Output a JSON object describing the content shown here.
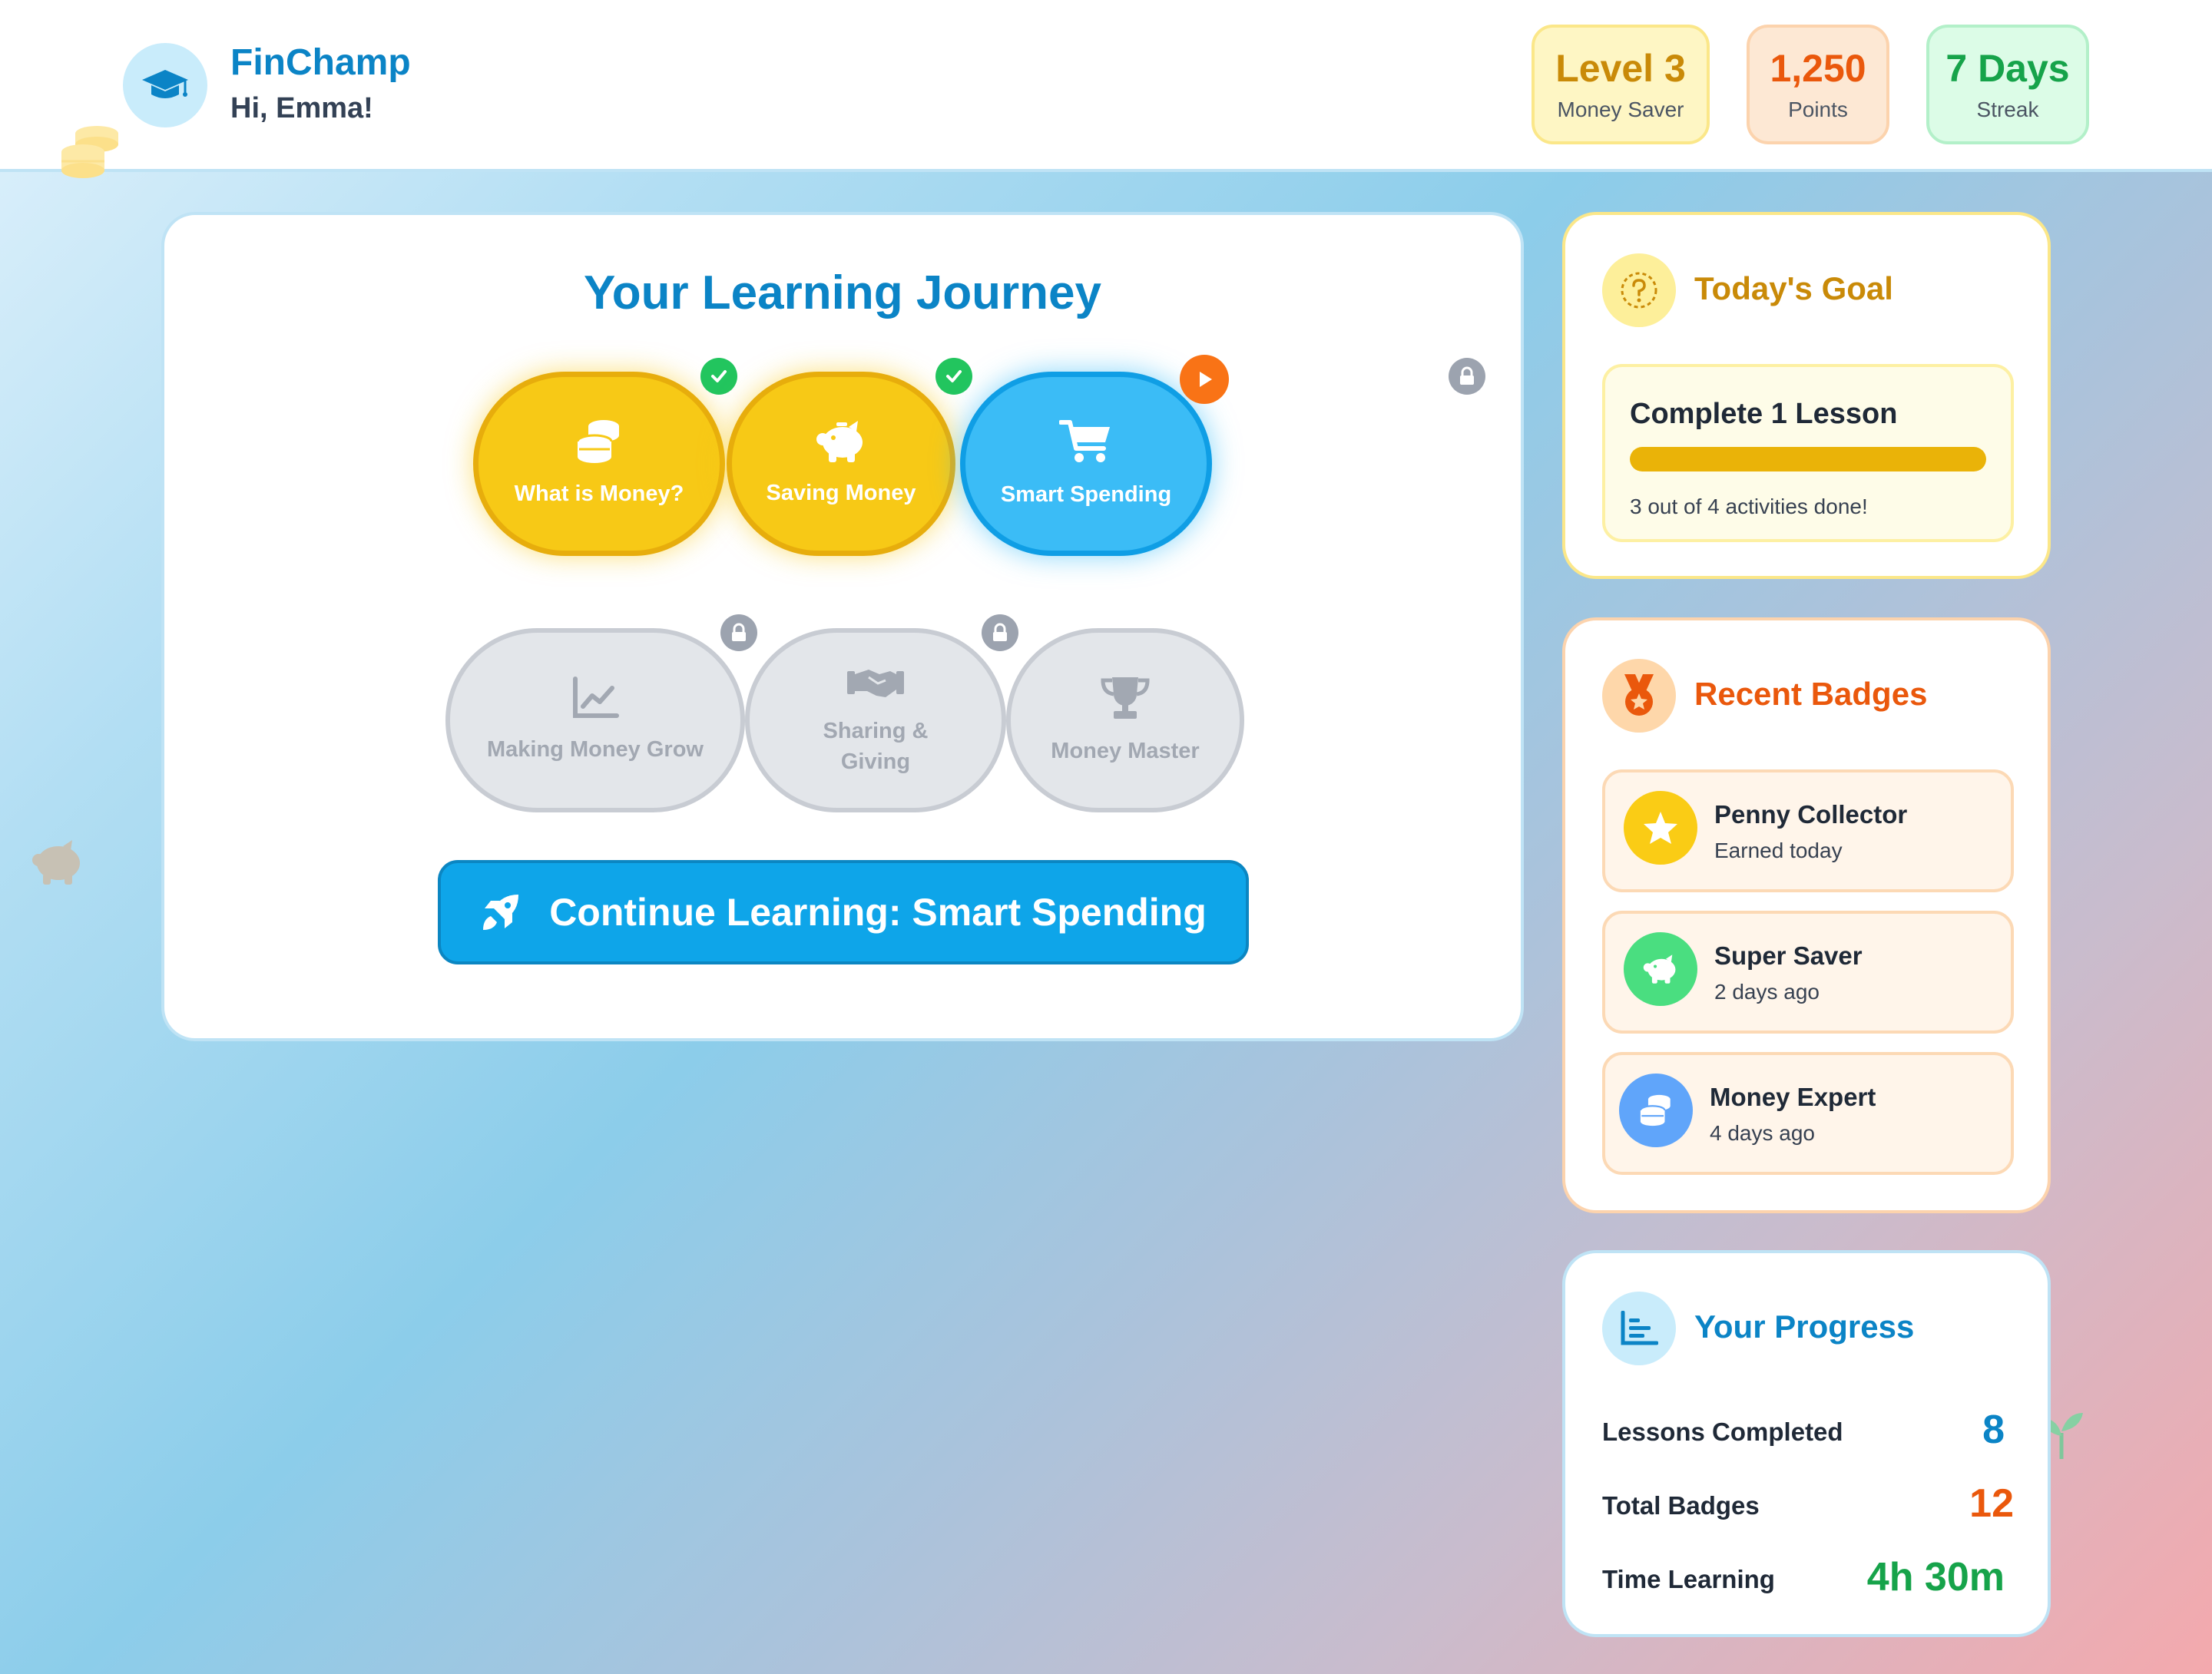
{
  "header": {
    "app_name": "FinChamp",
    "greeting": "Hi, Emma!",
    "logo_icon": "graduation-cap-icon",
    "stats": {
      "level": {
        "value": "Level 3",
        "caption": "Money Saver"
      },
      "points": {
        "value": "1,250",
        "caption": "Points"
      },
      "streak": {
        "value": "7 Days",
        "caption": "Streak"
      }
    }
  },
  "journey": {
    "title": "Your Learning Journey",
    "nodes": [
      {
        "label": "What is Money?",
        "icon": "coins-icon",
        "status": "completed"
      },
      {
        "label": "Saving Money",
        "icon": "piggy-bank-icon",
        "status": "completed"
      },
      {
        "label": "Smart Spending",
        "icon": "shopping-cart-icon",
        "status": "current"
      },
      {
        "label": "Making Money Grow",
        "icon": "chart-line-icon",
        "status": "locked"
      },
      {
        "label": "Sharing & Giving",
        "icon": "handshake-icon",
        "status": "locked"
      },
      {
        "label": "Money Master",
        "icon": "trophy-icon",
        "status": "locked"
      }
    ],
    "cta_label": "Continue Learning: Smart Spending",
    "cta_icon": "rocket-icon"
  },
  "goal": {
    "title": "Today's Goal",
    "icon": "question-circle-icon",
    "lesson_text": "Complete 1 Lesson",
    "progress_fraction": 1.0,
    "progress_text": "3 out of 4 activities done!"
  },
  "badges": {
    "title": "Recent Badges",
    "icon": "medal-icon",
    "items": [
      {
        "name": "Penny Collector",
        "when": "Earned today",
        "icon": "star-icon",
        "color": "#facc15"
      },
      {
        "name": "Super Saver",
        "when": "2 days ago",
        "icon": "piggy-bank-icon",
        "color": "#4ade80"
      },
      {
        "name": "Money Expert",
        "when": "4 days ago",
        "icon": "coins-icon",
        "color": "#60a5fa"
      }
    ]
  },
  "progress": {
    "title": "Your Progress",
    "icon": "bar-chart-icon",
    "rows": [
      {
        "label": "Lessons Completed",
        "value": "8",
        "color": "#0b84c6"
      },
      {
        "label": "Total Badges",
        "value": "12",
        "color": "#ea580c"
      },
      {
        "label": "Time Learning",
        "value": "4h 30m",
        "color": "#16a34a"
      }
    ]
  },
  "colors": {
    "brand": "#0b84c6",
    "completed": "#f7c916",
    "current": "#3bbcf6",
    "locked": "#e3e6ea",
    "cta": "#0ea5e9"
  }
}
